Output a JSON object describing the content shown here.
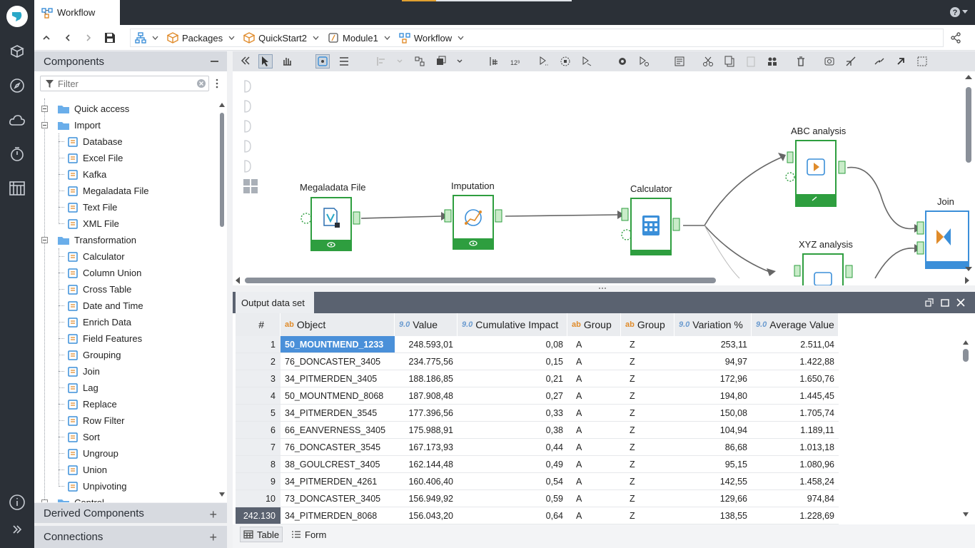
{
  "window": {
    "tab_title": "Workflow"
  },
  "breadcrumbs": [
    {
      "label": "Packages",
      "icon": "package-icon"
    },
    {
      "label": "QuickStart2",
      "icon": "package-icon"
    },
    {
      "label": "Module1",
      "icon": "module-icon"
    },
    {
      "label": "Workflow",
      "icon": "workflow-icon"
    }
  ],
  "components": {
    "title": "Components",
    "filter_placeholder": "Filter",
    "quick_access": "Quick access",
    "import": "Import",
    "import_items": [
      "Database",
      "Excel File",
      "Kafka",
      "Megaladata File",
      "Text File",
      "XML File"
    ],
    "transformation": "Transformation",
    "transformation_items": [
      "Calculator",
      "Column Union",
      "Cross Table",
      "Date and Time",
      "Enrich Data",
      "Field Features",
      "Grouping",
      "Join",
      "Lag",
      "Replace",
      "Row Filter",
      "Sort",
      "Ungroup",
      "Union",
      "Unpivoting"
    ],
    "control": "Control"
  },
  "derived_components": "Derived Components",
  "connections": "Connections",
  "workflow_nodes": {
    "megaladata_file": "Megaladata File",
    "imputation": "Imputation",
    "calculator": "Calculator",
    "abc": "ABC analysis",
    "xyz": "XYZ analysis",
    "join": "Join"
  },
  "output": {
    "tab": "Output data set",
    "columns": [
      {
        "type": "",
        "label": "#"
      },
      {
        "type": "ab",
        "label": "Object"
      },
      {
        "type": "9.0",
        "label": "Value"
      },
      {
        "type": "9.0",
        "label": "Cumulative Impact"
      },
      {
        "type": "ab",
        "label": "Group"
      },
      {
        "type": "ab",
        "label": "Group"
      },
      {
        "type": "9.0",
        "label": "Variation %"
      },
      {
        "type": "9.0",
        "label": "Average Value"
      }
    ],
    "rows": [
      [
        "1",
        "50_MOUNTMEND_1233",
        "248.593,01",
        "0,08",
        "A",
        "Z",
        "253,11",
        "2.511,04"
      ],
      [
        "2",
        "76_DONCASTER_3405",
        "234.775,56",
        "0,15",
        "A",
        "Z",
        "94,97",
        "1.422,88"
      ],
      [
        "3",
        "34_PITMERDEN_3405",
        "188.186,85",
        "0,21",
        "A",
        "Z",
        "172,96",
        "1.650,76"
      ],
      [
        "4",
        "50_MOUNTMEND_8068",
        "187.908,48",
        "0,27",
        "A",
        "Z",
        "194,80",
        "1.445,45"
      ],
      [
        "5",
        "34_PITMERDEN_3545",
        "177.396,56",
        "0,33",
        "A",
        "Z",
        "150,08",
        "1.705,74"
      ],
      [
        "6",
        "66_EANVERNESS_3405",
        "175.988,91",
        "0,38",
        "A",
        "Z",
        "104,94",
        "1.189,11"
      ],
      [
        "7",
        "76_DONCASTER_3545",
        "167.173,93",
        "0,44",
        "A",
        "Z",
        "86,68",
        "1.013,18"
      ],
      [
        "8",
        "38_GOULCREST_3405",
        "162.144,48",
        "0,49",
        "A",
        "Z",
        "95,15",
        "1.080,96"
      ],
      [
        "9",
        "34_PITMERDEN_4261",
        "160.406,40",
        "0,54",
        "A",
        "Z",
        "142,55",
        "1.458,24"
      ],
      [
        "10",
        "73_DONCASTER_3405",
        "156.949,92",
        "0,59",
        "A",
        "Z",
        "129,66",
        "974,84"
      ],
      [
        "242.130",
        "34_PITMERDEN_8068",
        "156.043,20",
        "0,64",
        "A",
        "Z",
        "138,55",
        "1.228,69"
      ]
    ],
    "view_tabs": {
      "table": "Table",
      "form": "Form"
    }
  },
  "colors": {
    "accent_green": "#2e9e3f",
    "join_blue": "#3b8fd9",
    "selection": "#4a90d9"
  }
}
